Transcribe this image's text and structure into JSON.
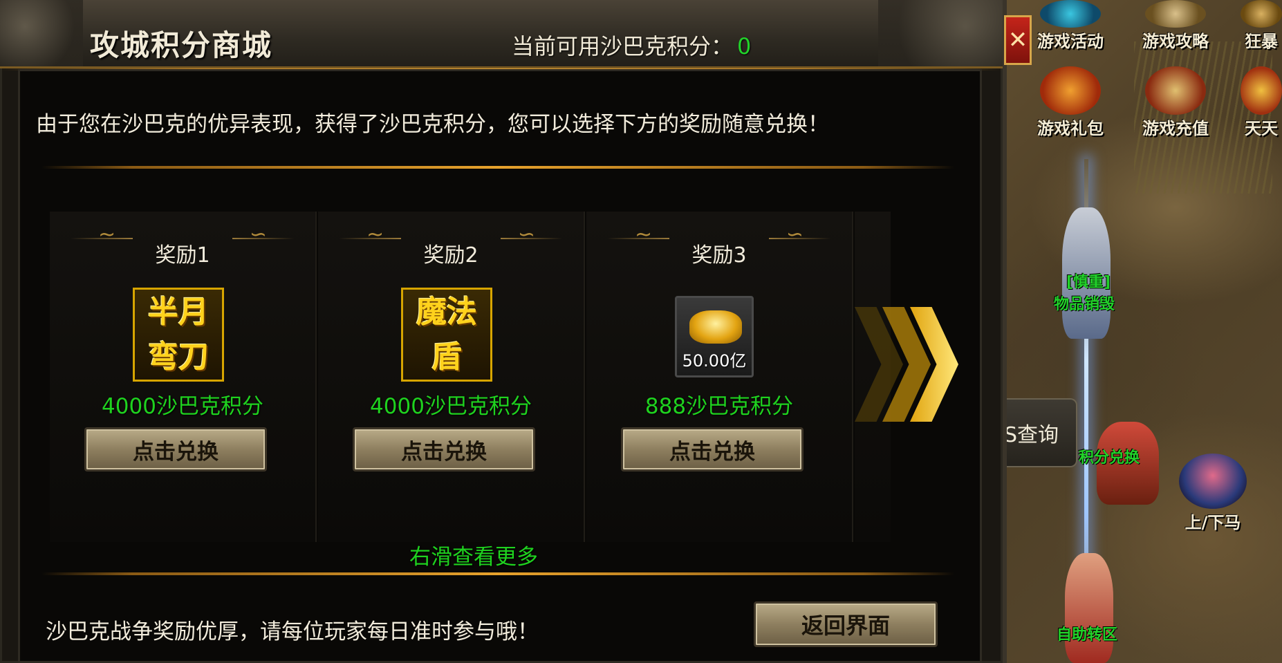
{
  "window": {
    "title": "攻城积分商城",
    "points_label": "当前可用沙巴克积分：",
    "points_value": "0",
    "close_label": "✕"
  },
  "intro_text": "由于您在沙巴克的优异表现，获得了沙巴克积分，您可以选择下方的奖励随意兑换！",
  "rewards": [
    {
      "title": "奖励1",
      "icon_lines": [
        "半月",
        "弯刀"
      ],
      "cost": "4000沙巴克积分",
      "button": "点击兑换"
    },
    {
      "title": "奖励2",
      "icon_lines": [
        "魔法",
        "盾"
      ],
      "cost": "4000沙巴克积分",
      "button": "点击兑换"
    },
    {
      "title": "奖励3",
      "icon": "gold-ingot-icon",
      "quantity": "50.00亿",
      "cost": "888沙巴克积分",
      "button": "点击兑换"
    }
  ],
  "scroll_hint": "右滑查看更多",
  "footer_text": "沙巴克战争奖励优厚，请每位玩家每日准时参与哦！",
  "back_button": "返回界面",
  "hud": {
    "activity": "游戏活动",
    "guide": "游戏攻略",
    "frenzy": "狂暴",
    "gift": "游戏礼包",
    "recharge": "游戏充值",
    "daily": "天天",
    "boss_query": "S查询",
    "mount": "上/下马"
  },
  "npcs": {
    "destroy": "物品销毁",
    "destroy_tag": "[慎重]",
    "points_exchange": "积分兑换",
    "auto_transfer": "自助转区"
  },
  "colors": {
    "green_text": "#22d22a",
    "gold_border": "#d7a500",
    "panel_bg": "#090806",
    "close_red": "#c4241a"
  }
}
